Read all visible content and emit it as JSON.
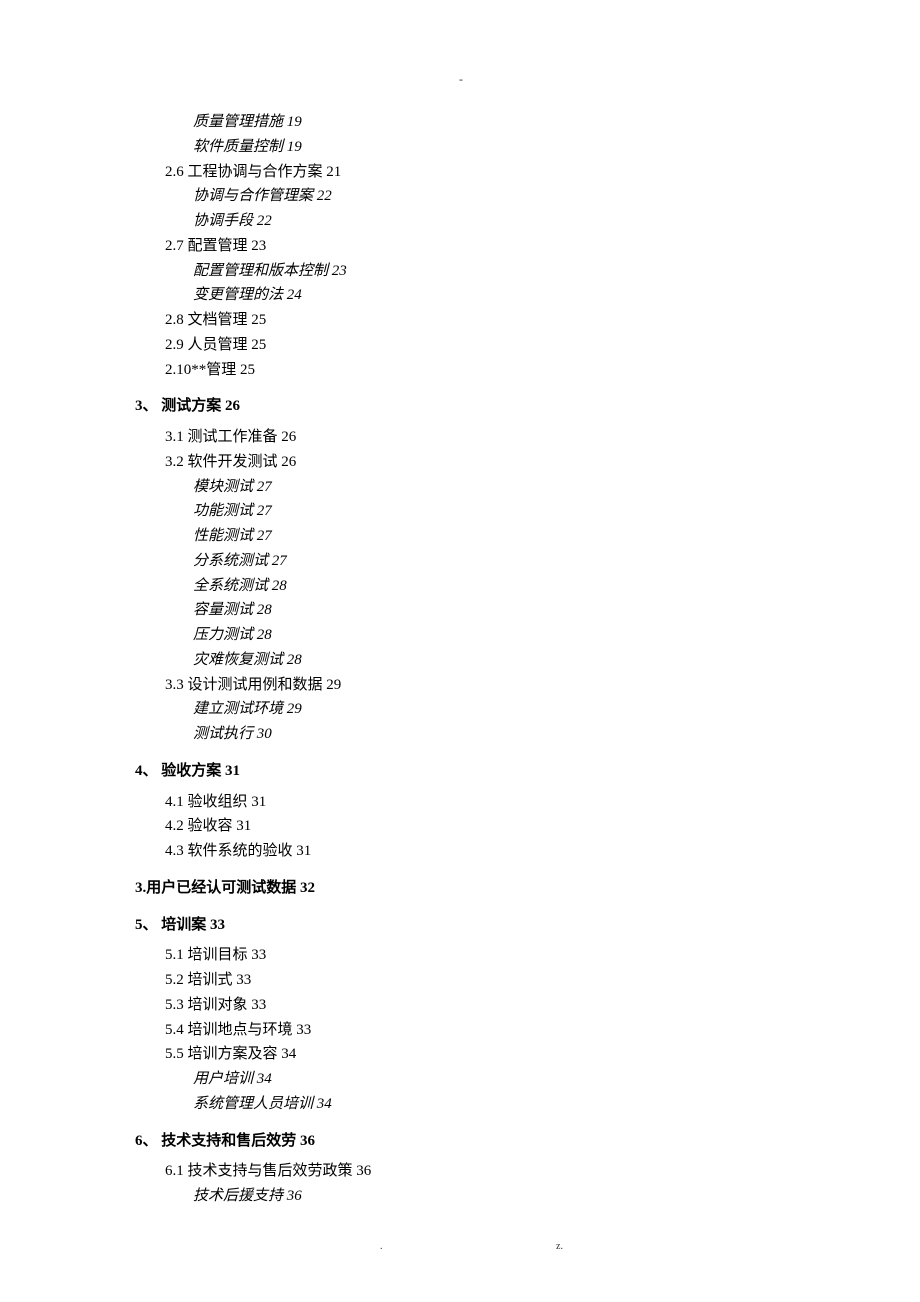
{
  "top_marker": "-",
  "footer_dot": ".",
  "footer_z": "z.",
  "lines": [
    {
      "cls": "l3",
      "text": "质量管理措施 19"
    },
    {
      "cls": "l3",
      "text": "软件质量控制 19"
    },
    {
      "cls": "l2",
      "text": "2.6 工程协调与合作方案 21"
    },
    {
      "cls": "l3",
      "text": "协调与合作管理案 22"
    },
    {
      "cls": "l3",
      "text": "协调手段 22"
    },
    {
      "cls": "l2",
      "text": "2.7 配置管理 23"
    },
    {
      "cls": "l3",
      "text": "配置管理和版本控制 23"
    },
    {
      "cls": "l3",
      "text": "变更管理的法 24"
    },
    {
      "cls": "l2",
      "text": "2.8 文档管理 25"
    },
    {
      "cls": "l2",
      "text": "2.9 人员管理 25"
    },
    {
      "cls": "l2",
      "text": "2.10**管理 25"
    },
    {
      "cls": "l1",
      "text": "3、 测试方案 26"
    },
    {
      "cls": "l2",
      "text": "3.1 测试工作准备 26"
    },
    {
      "cls": "l2",
      "text": "3.2 软件开发测试 26"
    },
    {
      "cls": "l3",
      "text": "模块测试 27"
    },
    {
      "cls": "l3",
      "text": "功能测试 27"
    },
    {
      "cls": "l3",
      "text": "性能测试 27"
    },
    {
      "cls": "l3",
      "text": "分系统测试 27"
    },
    {
      "cls": "l3",
      "text": "全系统测试 28"
    },
    {
      "cls": "l3",
      "text": "容量测试 28"
    },
    {
      "cls": "l3",
      "text": "压力测试 28"
    },
    {
      "cls": "l3",
      "text": "灾难恢复测试 28"
    },
    {
      "cls": "l2",
      "text": "3.3 设计测试用例和数据 29"
    },
    {
      "cls": "l3",
      "text": "建立测试环境 29"
    },
    {
      "cls": "l3",
      "text": "测试执行 30"
    },
    {
      "cls": "l1",
      "text": "4、 验收方案 31"
    },
    {
      "cls": "l2",
      "text": "4.1 验收组织 31"
    },
    {
      "cls": "l2",
      "text": "4.2 验收容 31"
    },
    {
      "cls": "l2",
      "text": "4.3 软件系统的验收 31"
    },
    {
      "cls": "l1",
      "text": "3.用户已经认可测试数据 32"
    },
    {
      "cls": "l1",
      "text": "5、 培训案 33"
    },
    {
      "cls": "l2",
      "text": "5.1 培训目标 33"
    },
    {
      "cls": "l2",
      "text": "5.2 培训式 33"
    },
    {
      "cls": "l2",
      "text": "5.3 培训对象 33"
    },
    {
      "cls": "l2",
      "text": "5.4 培训地点与环境 33"
    },
    {
      "cls": "l2",
      "text": "5.5 培训方案及容 34"
    },
    {
      "cls": "l3",
      "text": "用户培训 34"
    },
    {
      "cls": "l3",
      "text": "系统管理人员培训 34"
    },
    {
      "cls": "l1",
      "text": "6、 技术支持和售后效劳 36"
    },
    {
      "cls": "l2",
      "text": "6.1 技术支持与售后效劳政策 36"
    },
    {
      "cls": "l3",
      "text": "技术后援支持 36"
    }
  ]
}
